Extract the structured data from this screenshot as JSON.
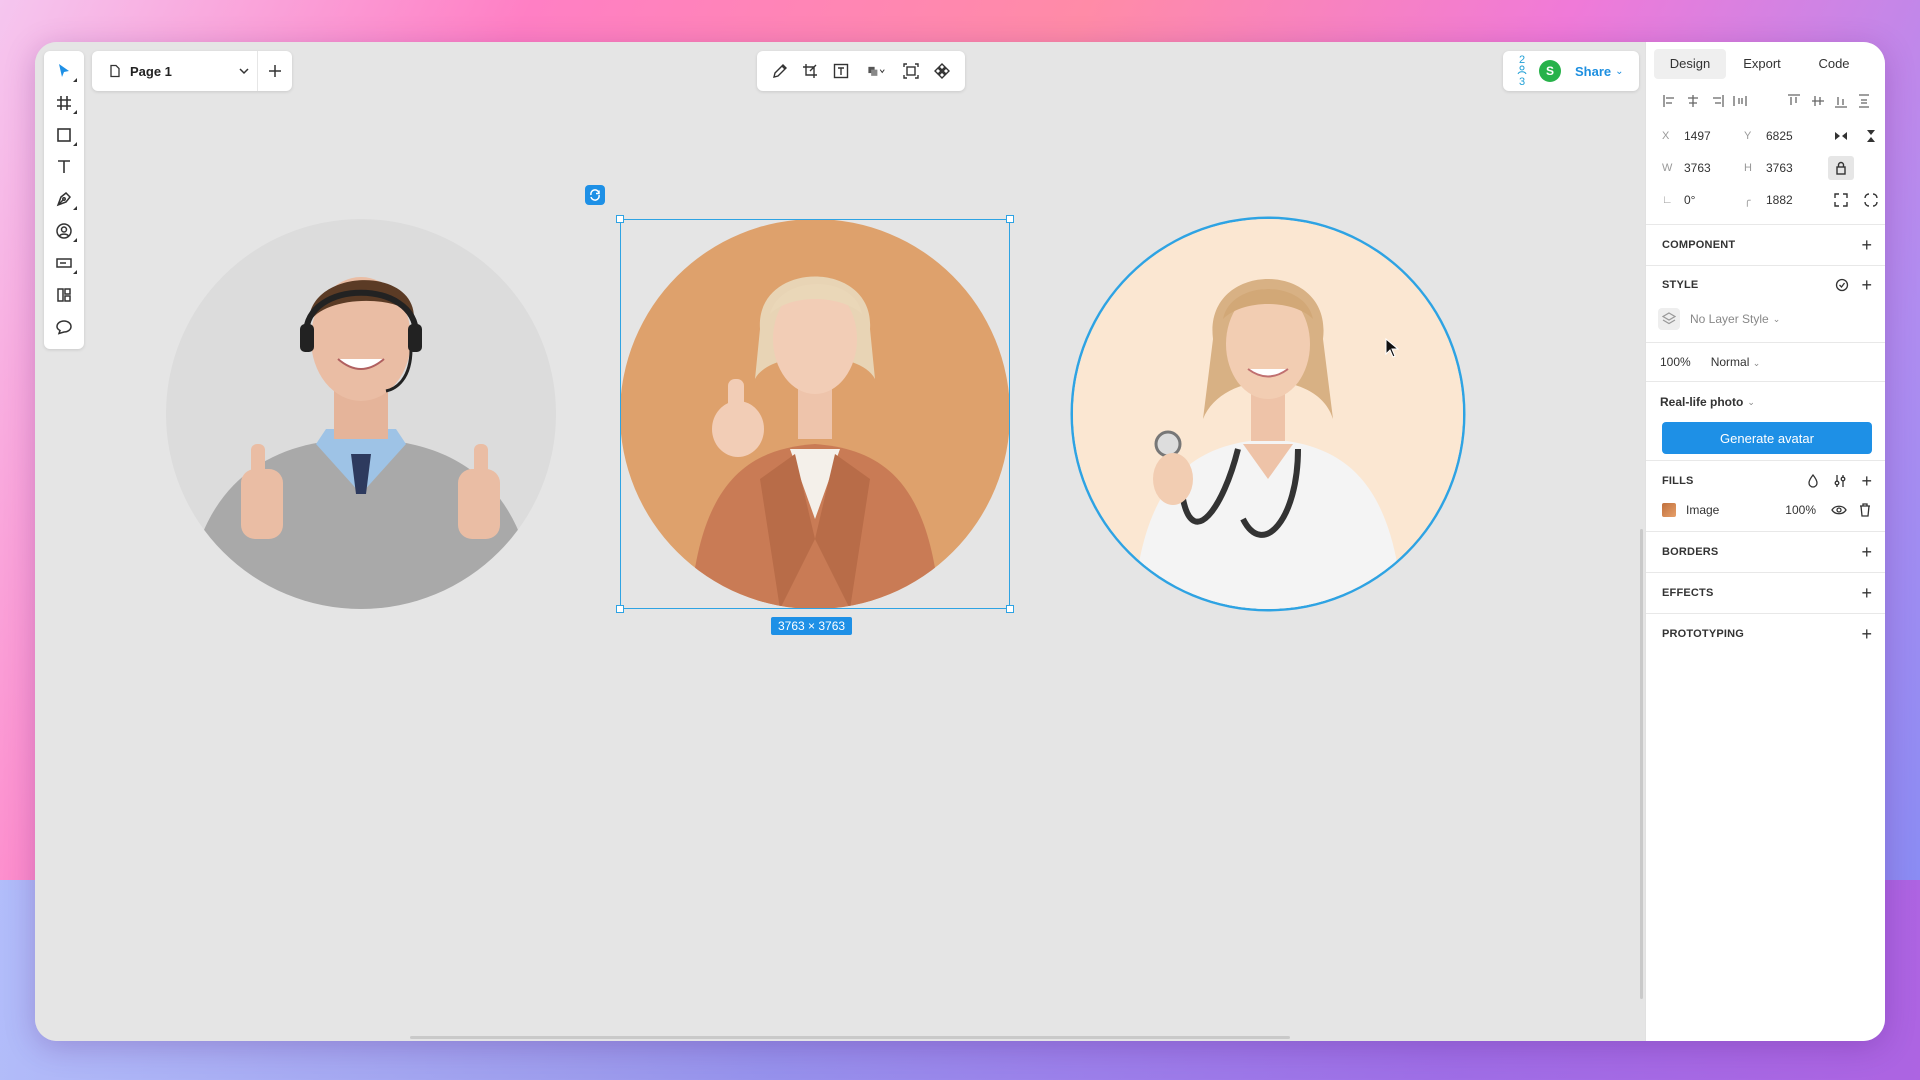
{
  "app": {
    "page_selector": {
      "name": "Page 1"
    },
    "share": {
      "count_top": "2",
      "count_bottom": "3",
      "avatar_initial": "S",
      "label": "Share"
    },
    "selection_label": "3763 × 3763",
    "colors": {
      "accent": "#1e90e6",
      "selection": "#2ea3e3",
      "avatar_green": "#27b24a"
    }
  },
  "left_toolbar": [
    {
      "name": "move-tool",
      "icon": "cursor-arrow-icon"
    },
    {
      "name": "frame-tool",
      "icon": "hash-frame-icon"
    },
    {
      "name": "rectangle-tool",
      "icon": "square-icon"
    },
    {
      "name": "text-tool",
      "icon": "text-t-icon"
    },
    {
      "name": "pen-tool",
      "icon": "pen-icon"
    },
    {
      "name": "avatar-tool",
      "icon": "user-circle-icon"
    },
    {
      "name": "input-tool",
      "icon": "input-field-icon"
    },
    {
      "name": "layout-tool",
      "icon": "layout-icon"
    },
    {
      "name": "comment-tool",
      "icon": "comment-bubble-icon"
    }
  ],
  "center_toolbar": [
    "pencil-icon",
    "crop-icon",
    "text-box-icon",
    "shapes-icon",
    "frame-select-icon",
    "component-icon"
  ],
  "panel": {
    "tabs": [
      {
        "label": "Design",
        "active": true
      },
      {
        "label": "Export",
        "active": false
      },
      {
        "label": "Code",
        "active": false
      }
    ],
    "position": {
      "x_label": "X",
      "x": "1497",
      "y_label": "Y",
      "y": "6825"
    },
    "size": {
      "w_label": "W",
      "w": "3763",
      "h_label": "H",
      "h": "3763"
    },
    "rotation": "0°",
    "radius": "1882",
    "sections": {
      "component": "COMPONENT",
      "style": "STYLE",
      "fills": "FILLS",
      "borders": "BORDERS",
      "effects": "EFFECTS",
      "prototyping": "PROTOTYPING"
    },
    "layer_style": "No Layer Style",
    "opacity": "100%",
    "blend_mode": "Normal",
    "photo_type": "Real-life photo",
    "generate_button": "Generate avatar",
    "fill": {
      "type": "Image",
      "opacity": "100%"
    }
  }
}
